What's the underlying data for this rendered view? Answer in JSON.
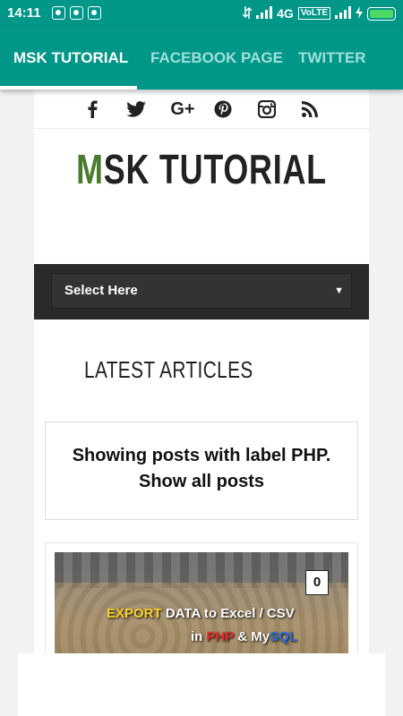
{
  "status_bar": {
    "time": "14:11",
    "network": "4G",
    "volte": "VoLTE",
    "notification_icons": [
      "notification-icon",
      "notification-icon",
      "notification-icon"
    ]
  },
  "tabs": [
    {
      "label": "MSK TUTORIAL",
      "active": true
    },
    {
      "label": "FACEBOOK PAGE",
      "active": false
    },
    {
      "label": "TWITTER",
      "active": false
    }
  ],
  "social_icons": [
    "facebook-icon",
    "twitter-icon",
    "google-plus-icon",
    "pinterest-icon",
    "instagram-icon",
    "rss-icon"
  ],
  "site": {
    "logo_first": "M",
    "logo_rest": "SK TUTORIAL"
  },
  "select": {
    "label": "Select Here"
  },
  "section": {
    "heading": "LATEST ARTICLES"
  },
  "label_notice": {
    "line1": "Showing posts with label PHP.",
    "line2": "Show all posts"
  },
  "post": {
    "comment_count": "0",
    "title_export": "EXPORT",
    "title_rest1": " DATA to Excel / CSV",
    "title_in": "in ",
    "title_php": "PHP",
    "title_amp": " & My",
    "title_sql": "SQL"
  },
  "colors": {
    "toolbar": "#009688",
    "logo_accent": "#4a7a2c",
    "select_bg": "#2a2a2a"
  }
}
